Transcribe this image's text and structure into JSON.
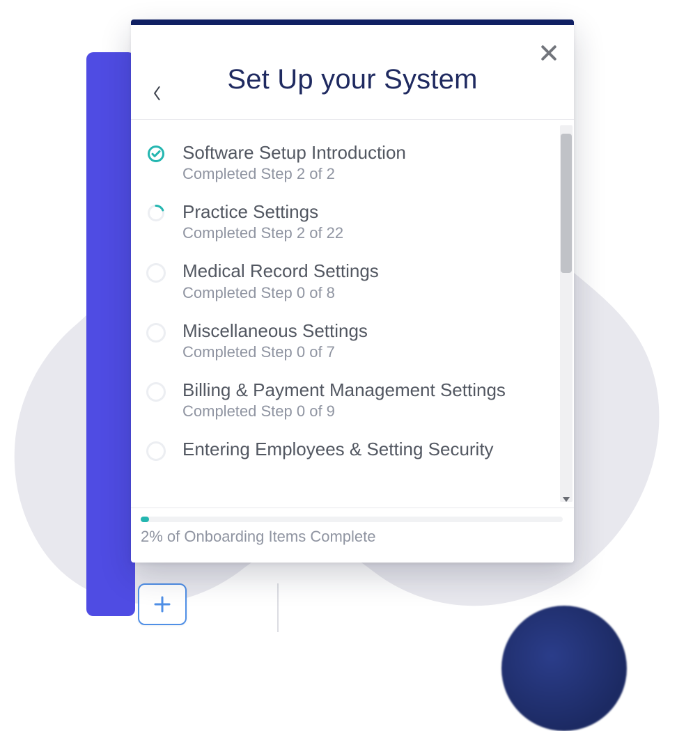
{
  "header": {
    "title": "Set Up your System"
  },
  "checklist": {
    "items": [
      {
        "title": "Software Setup Introduction",
        "sub": "Completed Step 2 of 2",
        "icon": "check"
      },
      {
        "title": "Practice Settings",
        "sub": "Completed Step 2 of 22",
        "icon": "partial"
      },
      {
        "title": "Medical Record Settings",
        "sub": "Completed Step 0 of 8",
        "icon": "empty"
      },
      {
        "title": "Miscellaneous Settings",
        "sub": "Completed Step 0 of 7",
        "icon": "empty"
      },
      {
        "title": "Billing & Payment Management Settings",
        "sub": "Completed Step 0 of 9",
        "icon": "empty"
      },
      {
        "title": "Entering Employees & Setting Security",
        "sub": "",
        "icon": "empty"
      }
    ]
  },
  "progress": {
    "percent": 2,
    "label": "2% of Onboarding Items Complete"
  }
}
